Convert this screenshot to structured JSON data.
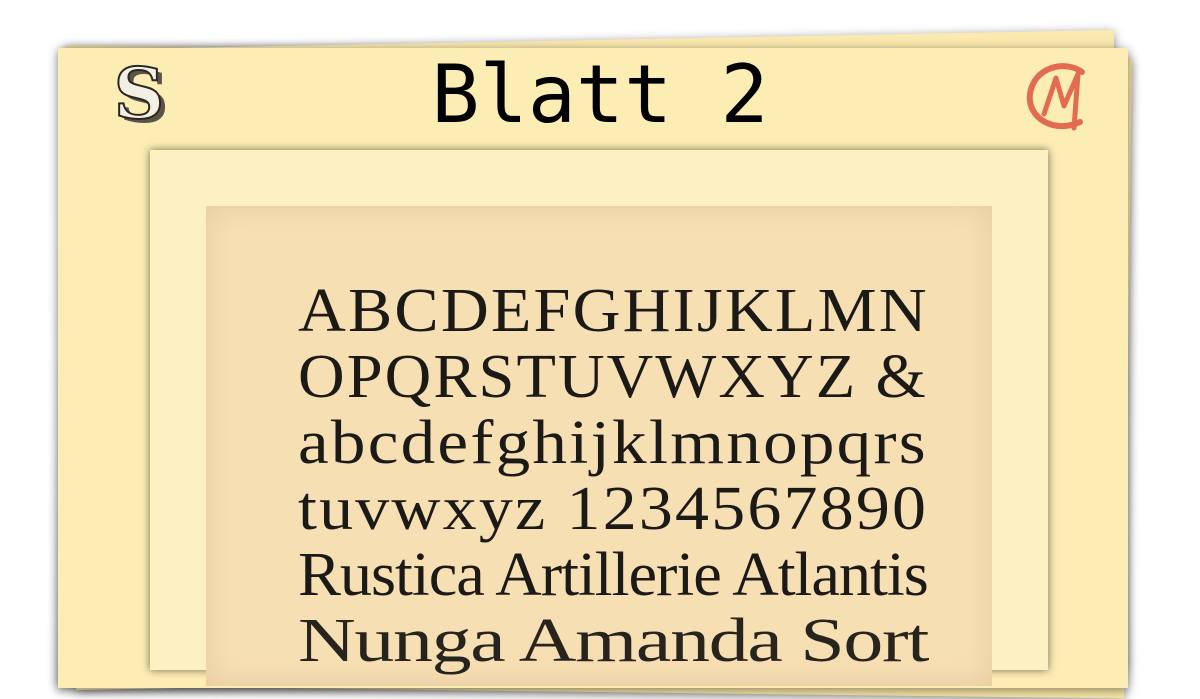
{
  "header": {
    "title": "Blatt 2",
    "logo_left_letter": "S",
    "logo_right_letters": "CM",
    "logo_right_color": "#e36b4f"
  },
  "specimen": {
    "lines": [
      "ABCDEFGHIJKLMN",
      "OPQRSTUVWXYZ &",
      "abcdefghijklmnopqrs",
      "tuvwxyz 1234567890",
      "Rustica Artillerie Atlantis",
      "Nunga Amanda Sort"
    ]
  },
  "colors": {
    "sheet": "#fcedb4",
    "plate": "#f7dfb4",
    "ink": "#1c1a17"
  }
}
